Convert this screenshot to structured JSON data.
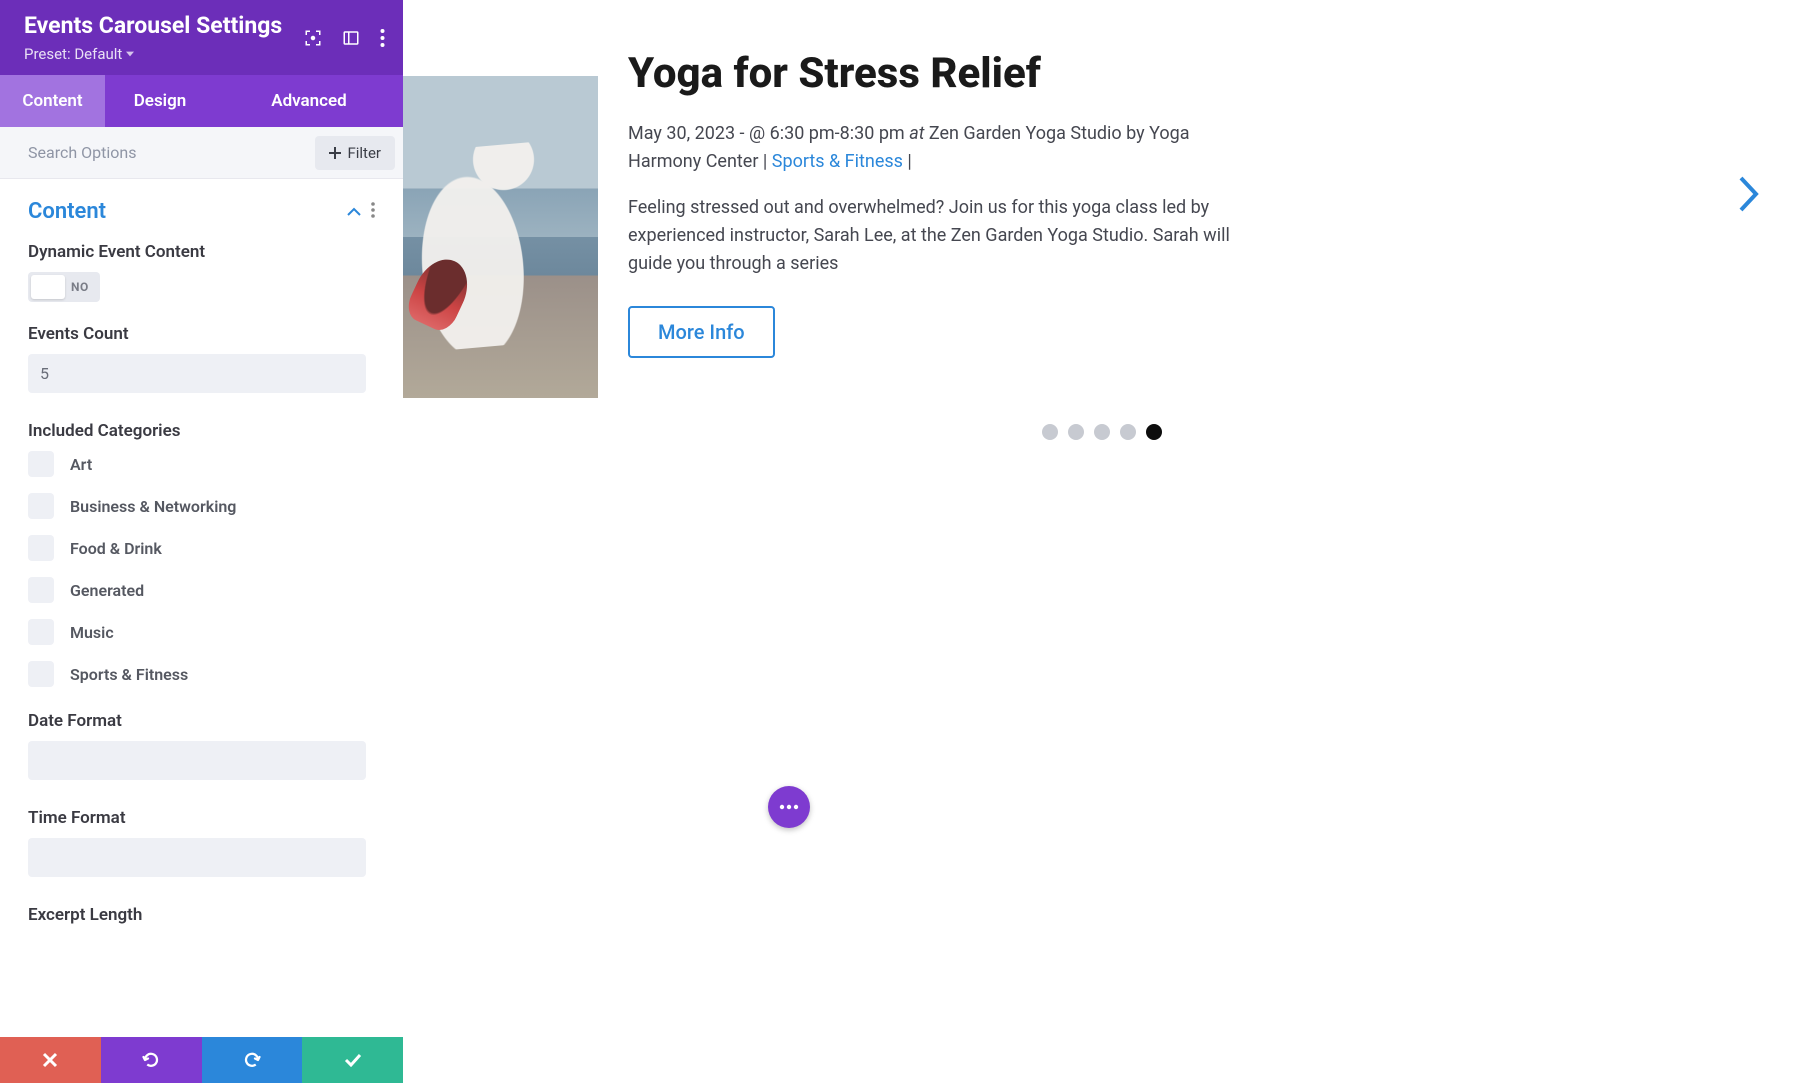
{
  "sidebar": {
    "title": "Events Carousel Settings",
    "preset_label": "Preset: Default",
    "tabs": [
      "Content",
      "Design",
      "Advanced"
    ],
    "active_tab": 0,
    "search_placeholder": "Search Options",
    "filter_label": "Filter",
    "section_title": "Content",
    "fields": {
      "dynamic_label": "Dynamic Event Content",
      "dynamic_toggle": "NO",
      "count_label": "Events Count",
      "count_value": "5",
      "categories_label": "Included Categories",
      "categories": [
        "Art",
        "Business & Networking",
        "Food & Drink",
        "Generated",
        "Music",
        "Sports & Fitness"
      ],
      "date_format_label": "Date Format",
      "date_format_value": "",
      "time_format_label": "Time Format",
      "time_format_value": "",
      "excerpt_label": "Excerpt Length"
    }
  },
  "event": {
    "title": "Yoga for Stress Relief",
    "date": "May 30, 2023",
    "time": "6:30 pm-8:30 pm",
    "at_word": "at",
    "venue": "Zen Garden Yoga Studio",
    "by_word": "by",
    "organizer": "Yoga Harmony Center",
    "category": "Sports & Fitness",
    "description": "Feeling stressed out and overwhelmed? Join us for this yoga class led by experienced instructor, Sarah Lee, at the Zen Garden Yoga Studio. Sarah will guide you through a series",
    "more_label": "More Info"
  },
  "carousel": {
    "dot_count": 5,
    "active_dot": 4
  }
}
